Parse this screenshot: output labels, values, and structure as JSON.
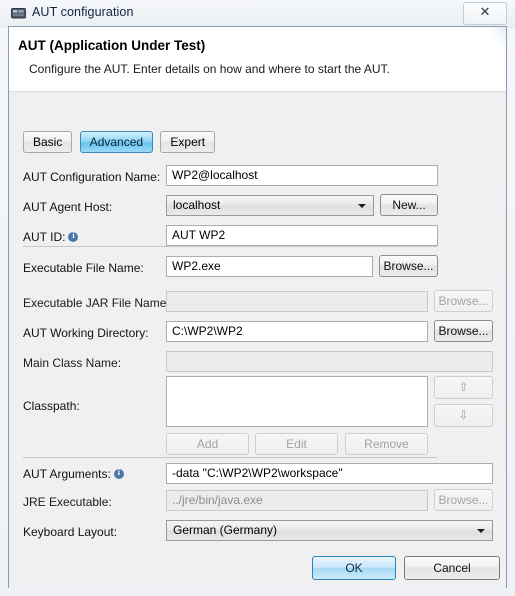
{
  "window": {
    "title": "AUT configuration",
    "icon": "app-icon",
    "close_label": "✕"
  },
  "header": {
    "title": "AUT (Application Under Test)",
    "description": "Configure the AUT. Enter details on how and where to start the AUT."
  },
  "tabs": [
    {
      "label": "Basic",
      "selected": false
    },
    {
      "label": "Advanced",
      "selected": true
    },
    {
      "label": "Expert",
      "selected": false
    }
  ],
  "fields": {
    "aut_configuration_name": {
      "label": "AUT Configuration Name:",
      "value": "WP2@localhost",
      "placeholder": ""
    },
    "aut_agent_host": {
      "label": "AUT Agent Host:",
      "value": "localhost",
      "options": [
        "localhost"
      ],
      "button": "New..."
    },
    "aut_id": {
      "label": "AUT ID:",
      "value": "AUT WP2",
      "info": "info-icon"
    },
    "executable_file_name": {
      "label": "Executable File Name:",
      "value": "WP2.exe",
      "button": "Browse..."
    },
    "executable_jar_file_name": {
      "label": "Executable JAR File Name:",
      "value": "",
      "button": "Browse..."
    },
    "aut_working_directory": {
      "label": "AUT Working Directory:",
      "value": "C:\\WP2\\WP2",
      "button": "Browse..."
    },
    "main_class_name": {
      "label": "Main Class Name:",
      "value": ""
    },
    "classpath": {
      "label": "Classpath:",
      "entries": [],
      "buttons": [
        "Add",
        "Edit",
        "Remove"
      ],
      "move_up": "⇧",
      "move_down": "⇩"
    },
    "aut_arguments": {
      "label": "AUT Arguments:",
      "value": "-data \"C:\\WP2\\WP2\\workspace\"",
      "info": "info-icon"
    },
    "jre_executable": {
      "label": "JRE Executable:",
      "value": "../jre/bin/java.exe",
      "button": "Browse..."
    },
    "keyboard_layout": {
      "label": "Keyboard Layout:",
      "value": "German (Germany)",
      "options": [
        "German (Germany)"
      ]
    }
  },
  "footer": {
    "ok": "OK",
    "cancel": "Cancel"
  },
  "colors": {
    "accent": "#64c3ee",
    "ok_border": "#2a80b9",
    "info": "#4a78a8",
    "dialog_bg": "#f0f0f0"
  }
}
